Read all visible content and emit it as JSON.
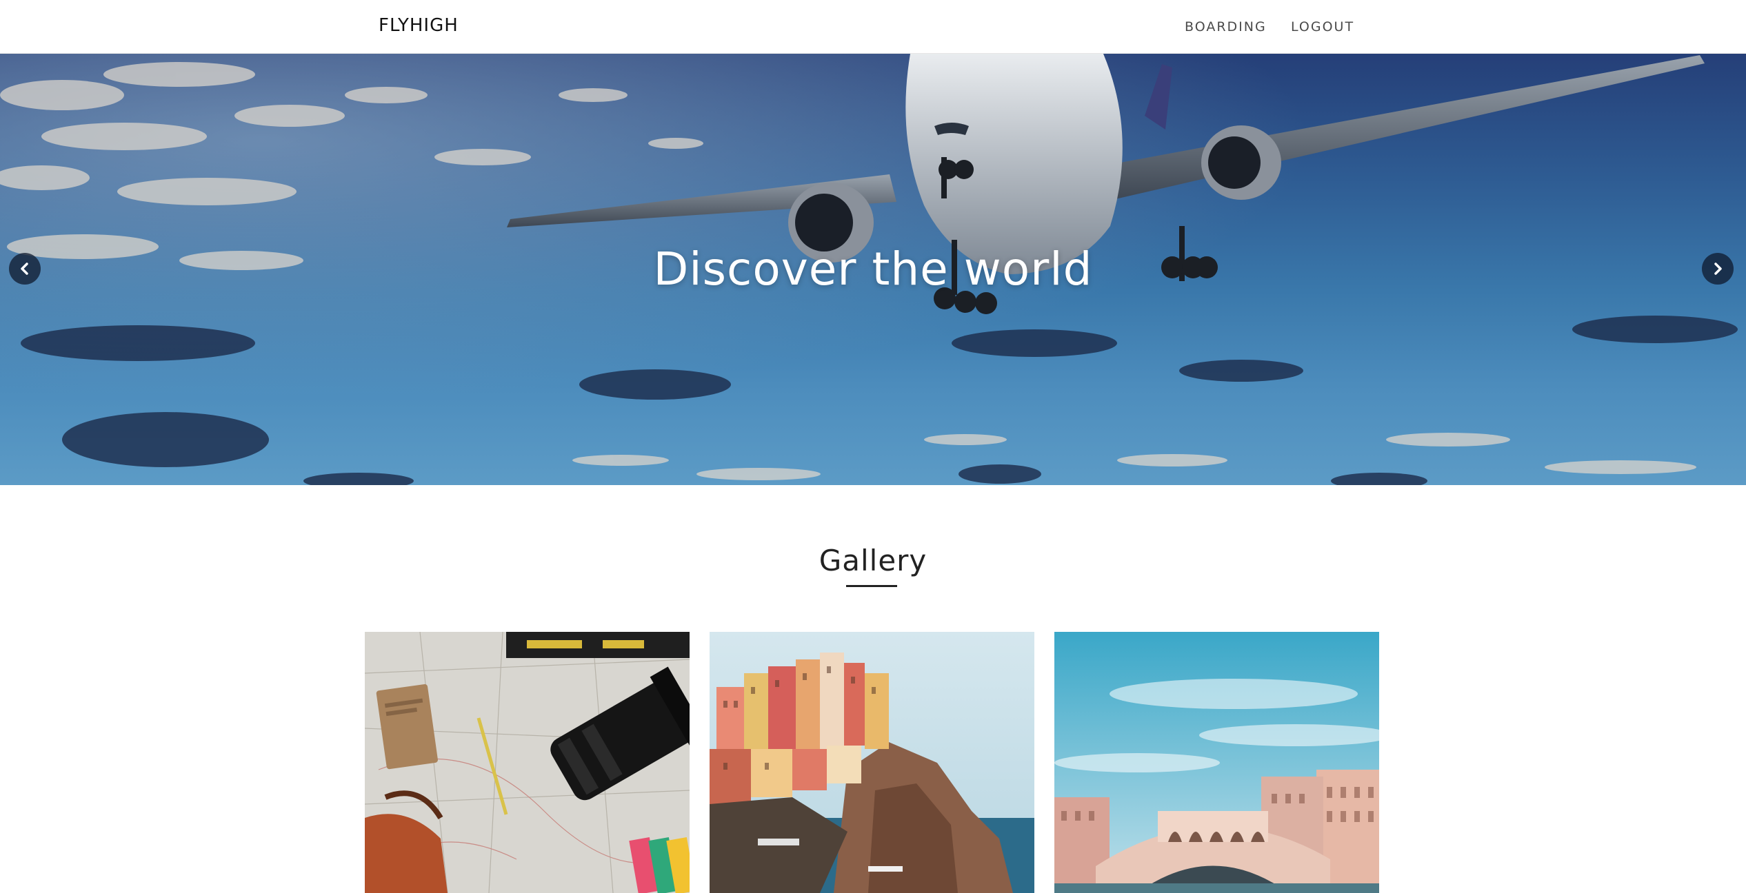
{
  "navbar": {
    "brand": "FLYHIGH",
    "links": [
      {
        "label": "BOARDING"
      },
      {
        "label": "LOGOUT"
      }
    ]
  },
  "hero": {
    "title": "Discover the world",
    "prev_icon": "chevron-left-icon",
    "next_icon": "chevron-right-icon"
  },
  "gallery": {
    "title": "Gallery",
    "images": [
      {
        "name": "travel-map-camera-photo"
      },
      {
        "name": "cliffside-colorful-village-photo"
      },
      {
        "name": "venice-bridge-photo"
      }
    ]
  }
}
